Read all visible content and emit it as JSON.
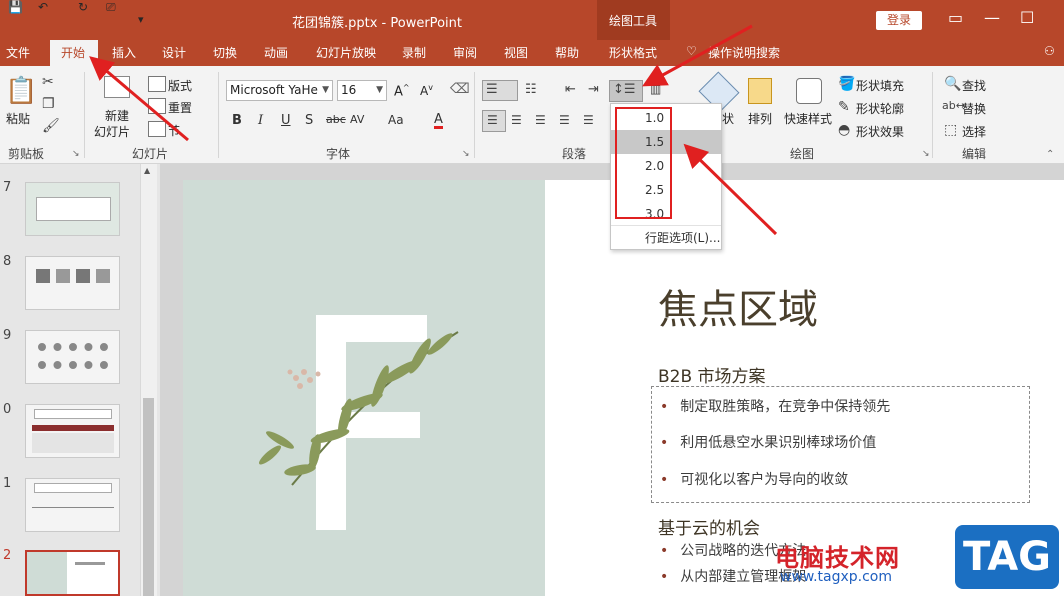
{
  "window": {
    "title": "花团锦簇.pptx  -  PowerPoint",
    "contextual_tab_group": "绘图工具",
    "login_label": "登录",
    "controls": {
      "restore": "▭",
      "minimize": "—",
      "maximize": "☐"
    }
  },
  "tabs": [
    {
      "label": "文件"
    },
    {
      "label": "开始"
    },
    {
      "label": "插入"
    },
    {
      "label": "设计"
    },
    {
      "label": "切换"
    },
    {
      "label": "动画"
    },
    {
      "label": "幻灯片放映"
    },
    {
      "label": "录制"
    },
    {
      "label": "审阅"
    },
    {
      "label": "视图"
    },
    {
      "label": "帮助"
    },
    {
      "label": "形状格式"
    },
    {
      "label": "操作说明搜索"
    }
  ],
  "ribbon": {
    "clipboard": {
      "paste": "粘贴",
      "group": "剪贴板"
    },
    "slides": {
      "new_slide_line1": "新建",
      "new_slide_line2": "幻灯片",
      "layout": "版式",
      "reset": "重置",
      "section": "节",
      "group": "幻灯片"
    },
    "font": {
      "name": "Microsoft YaHe",
      "size": "16",
      "group": "字体"
    },
    "paragraph": {
      "group": "段落"
    },
    "drawing": {
      "shape_fill": "形状填充",
      "shape_outline": "形状轮廓",
      "shape_effects": "形状效果",
      "arrange": "排列",
      "quick_styles": "快速样式",
      "group": "绘图",
      "partial_label": "状"
    },
    "editing": {
      "find": "查找",
      "replace": "替换",
      "select": "选择",
      "group": "编辑"
    }
  },
  "line_spacing_menu": {
    "items": [
      "1.0",
      "1.5",
      "2.0",
      "2.5",
      "3.0"
    ],
    "selected": "1.5",
    "options": "行距选项(L)..."
  },
  "thumbnails": [
    {
      "num": "7"
    },
    {
      "num": "8"
    },
    {
      "num": "9"
    },
    {
      "num": "0"
    },
    {
      "num": "1"
    },
    {
      "num": "2"
    }
  ],
  "slide": {
    "title": "焦点区域",
    "section1": {
      "title": "B2B 市场方案",
      "bullets": [
        "制定取胜策略，在竞争中保持领先",
        "利用低悬空水果识别棒球场价值",
        "可视化以客户为导向的收敛"
      ]
    },
    "section2": {
      "title": "基于云的机会",
      "bullets": [
        "公司战略的迭代方法",
        "从内部建立管理框架"
      ]
    }
  },
  "watermark": {
    "text": "电脑技术网",
    "url": "www.tagxp.com",
    "tag": "TAG"
  },
  "colors": {
    "accent": "#b7472a",
    "arrow": "#e02020"
  }
}
